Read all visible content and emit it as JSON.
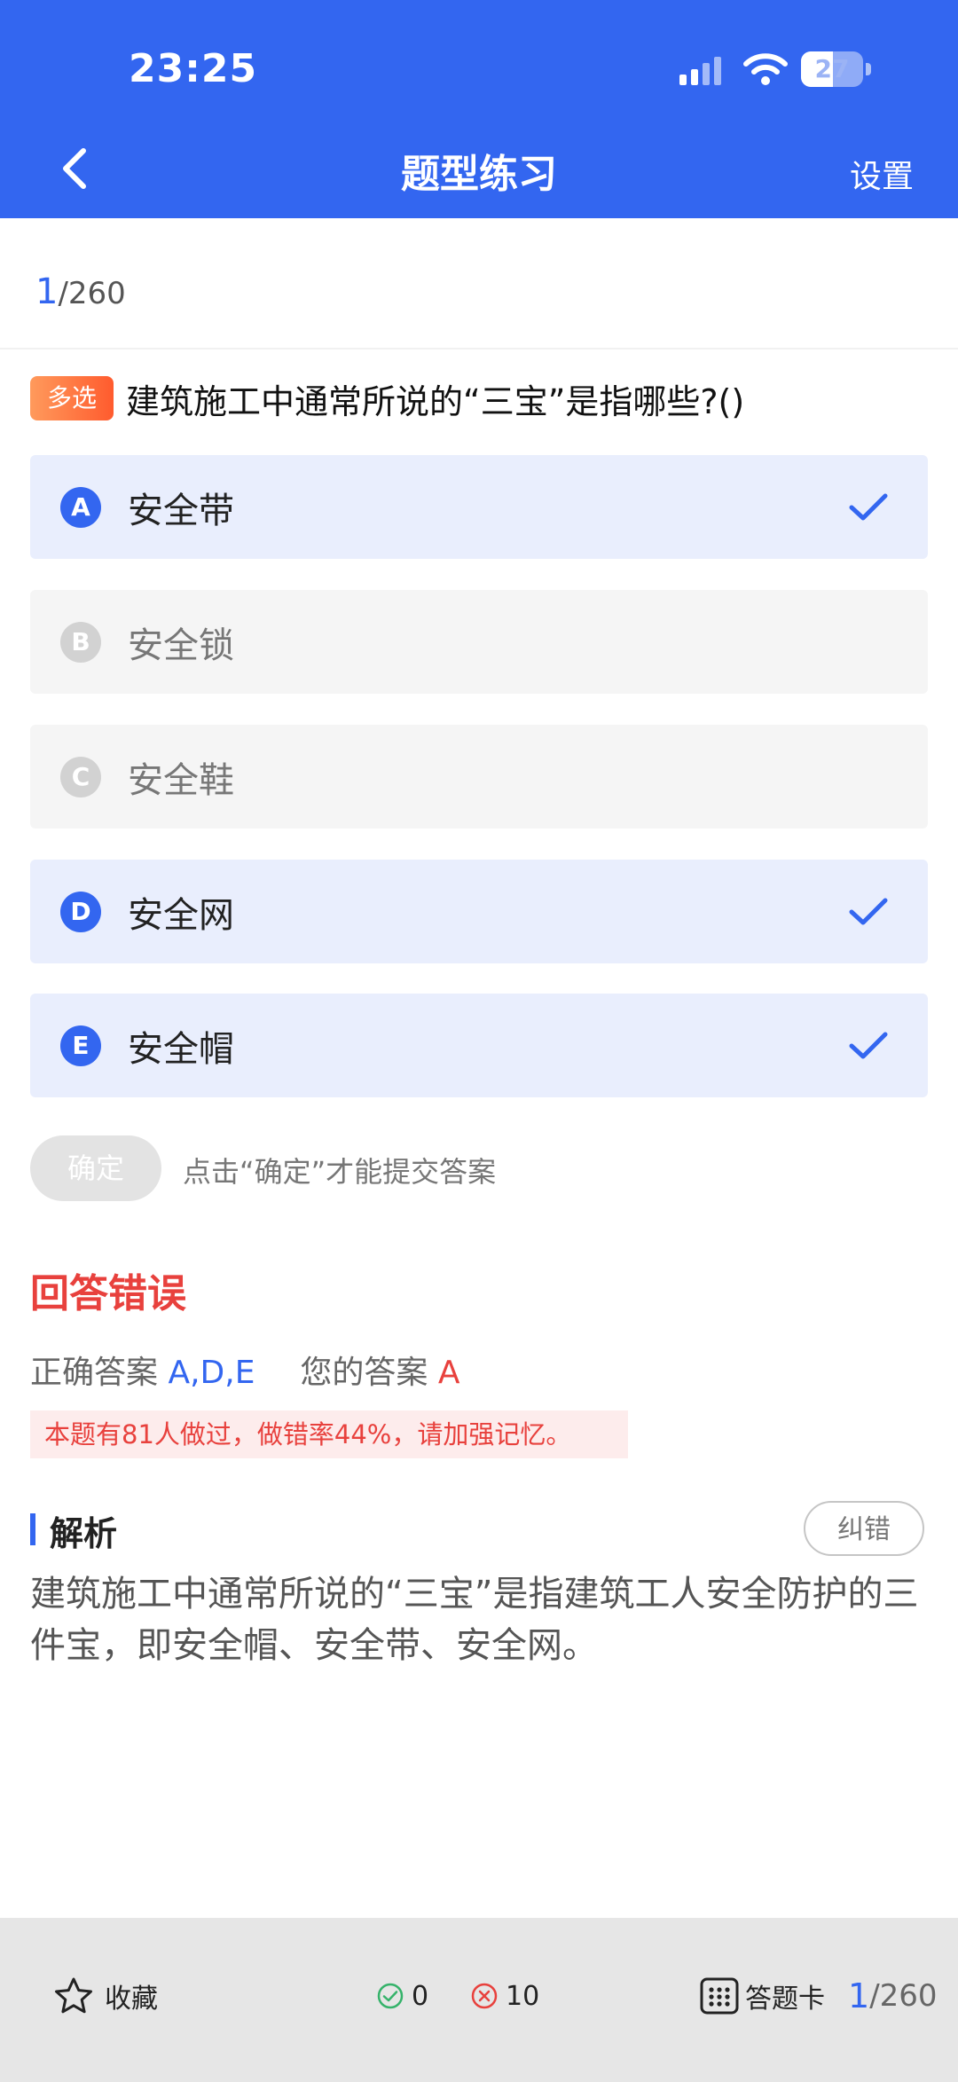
{
  "status_bar": {
    "time": "23:25",
    "battery": "27"
  },
  "nav": {
    "title": "题型练习",
    "settings_label": "设置",
    "back_icon": "chevron-left-icon"
  },
  "progress": {
    "current": "1",
    "total": "/260"
  },
  "question": {
    "type_tag": "多选",
    "text": "建筑施工中通常所说的“三宝”是指哪些?()",
    "options": [
      {
        "letter": "A",
        "text": "安全带",
        "selected": true
      },
      {
        "letter": "B",
        "text": "安全锁",
        "selected": false
      },
      {
        "letter": "C",
        "text": "安全鞋",
        "selected": false
      },
      {
        "letter": "D",
        "text": "安全网",
        "selected": true
      },
      {
        "letter": "E",
        "text": "安全帽",
        "selected": true
      }
    ]
  },
  "submit": {
    "button_label": "确定",
    "hint": "点击“确定”才能提交答案"
  },
  "result": {
    "status": "回答错误",
    "correct_label": "正确答案",
    "correct_value": "A,D,E",
    "your_label": "您的答案",
    "your_value": "A",
    "stats_note": "本题有81人做过，做错率44%，请加强记忆。"
  },
  "analysis": {
    "title": "解析",
    "report_label": "纠错",
    "text": "建筑施工中通常所说的“三宝”是指建筑工人安全防护的三件宝，即安全帽、安全带、安全网。"
  },
  "bottom_bar": {
    "favorite_label": "收藏",
    "correct_count": "0",
    "wrong_count": "10",
    "answer_card_label": "答题卡",
    "current": "1",
    "total": "/260"
  },
  "colors": {
    "primary": "#3366f0",
    "error": "#e8413d",
    "selected_bg": "#e9eefd"
  }
}
